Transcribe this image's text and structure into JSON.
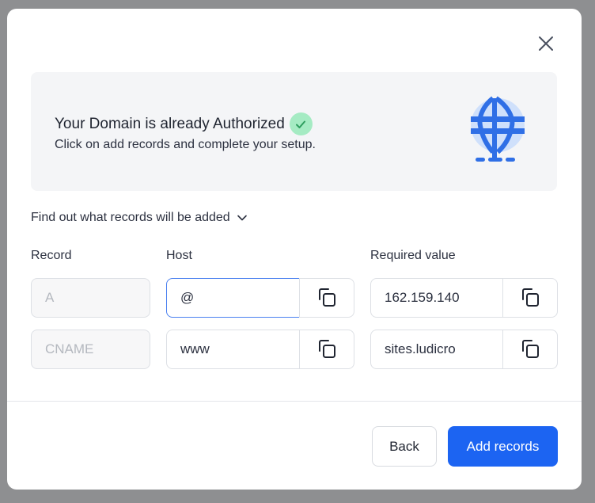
{
  "banner": {
    "title": "Your Domain is already Authorized",
    "subtitle": "Click on add records and complete your setup."
  },
  "toggle": {
    "label": "Find out what records will be added"
  },
  "columns": {
    "record": "Record",
    "host": "Host",
    "value": "Required value"
  },
  "rows": [
    {
      "record": "A",
      "host": "@",
      "value": "162.159.140"
    },
    {
      "record": "CNAME",
      "host": "www",
      "value": "sites.ludicro"
    }
  ],
  "footer": {
    "back_label": "Back",
    "add_label": "Add records"
  },
  "colors": {
    "primary": "#1c64f2",
    "success_badge": "#a5ebc3",
    "success_check": "#2f9e5f",
    "globe_light": "#cfe0fb",
    "globe_dark": "#2f6fe6"
  },
  "icons": {
    "close": "close-icon",
    "check": "check-icon",
    "globe": "globe-icon",
    "chevron": "chevron-down-icon",
    "copy": "copy-icon"
  }
}
